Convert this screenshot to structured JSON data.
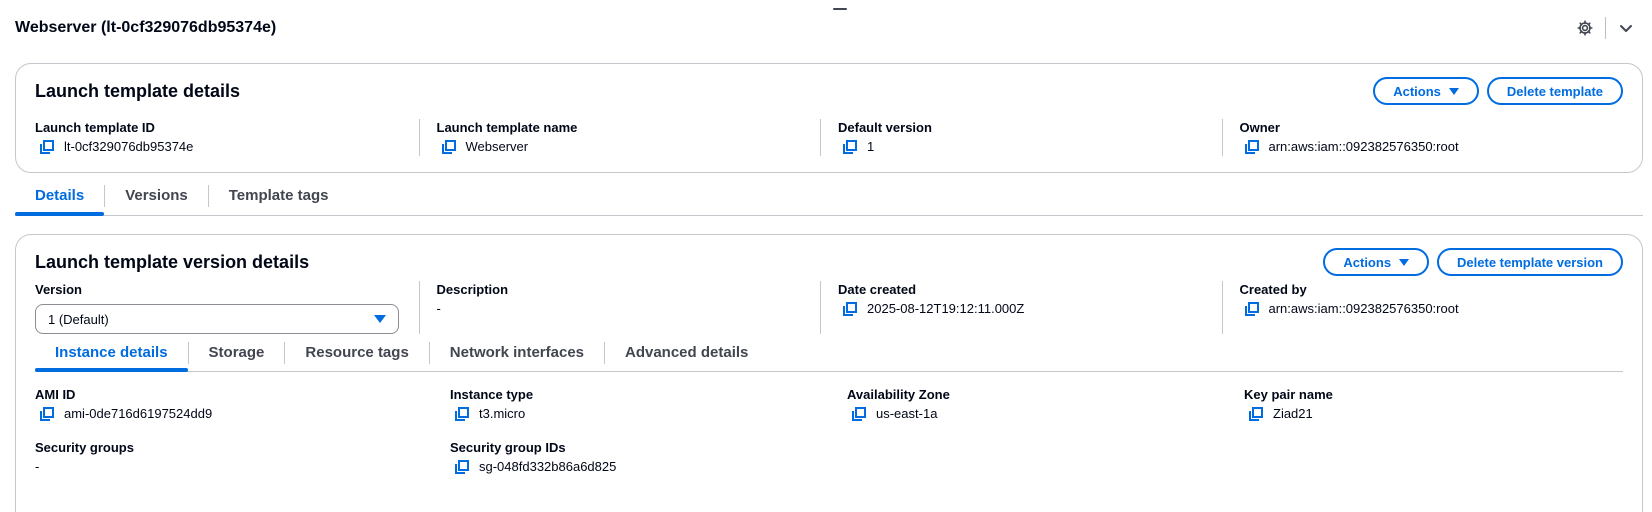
{
  "page": {
    "title": "Webserver (lt-0cf329076db95374e)"
  },
  "header_icons": [
    "gear-icon",
    "chevron-down-icon"
  ],
  "colors": {
    "accent": "#006ce0",
    "border": "#c6c6cd",
    "text": "#000716",
    "muted": "#424650"
  },
  "template_details": {
    "title": "Launch template details",
    "actions_label": "Actions",
    "delete_label": "Delete template",
    "fields": {
      "id": {
        "label": "Launch template ID",
        "value": "lt-0cf329076db95374e"
      },
      "name": {
        "label": "Launch template name",
        "value": "Webserver"
      },
      "default_version": {
        "label": "Default version",
        "value": "1"
      },
      "owner": {
        "label": "Owner",
        "value": "arn:aws:iam::092382576350:root"
      }
    }
  },
  "tabs": {
    "details": "Details",
    "versions": "Versions",
    "template_tags": "Template tags"
  },
  "version_details": {
    "title": "Launch template version details",
    "actions_label": "Actions",
    "delete_label": "Delete template version",
    "version": {
      "label": "Version",
      "selected": "1 (Default)"
    },
    "description": {
      "label": "Description",
      "value": "-"
    },
    "date_created": {
      "label": "Date created",
      "value": "2025-08-12T19:12:11.000Z"
    },
    "created_by": {
      "label": "Created by",
      "value": "arn:aws:iam::092382576350:root"
    },
    "subtabs": {
      "instance_details": "Instance details",
      "storage": "Storage",
      "resource_tags": "Resource tags",
      "network_interfaces": "Network interfaces",
      "advanced_details": "Advanced details"
    },
    "instance": {
      "ami_id": {
        "label": "AMI ID",
        "value": "ami-0de716d6197524dd9"
      },
      "instance_type": {
        "label": "Instance type",
        "value": "t3.micro"
      },
      "availability_zone": {
        "label": "Availability Zone",
        "value": "us-east-1a"
      },
      "key_pair": {
        "label": "Key pair name",
        "value": "Ziad21"
      },
      "security_groups": {
        "label": "Security groups",
        "value": "-"
      },
      "security_group_ids": {
        "label": "Security group IDs",
        "value": "sg-048fd332b86a6d825"
      }
    }
  }
}
